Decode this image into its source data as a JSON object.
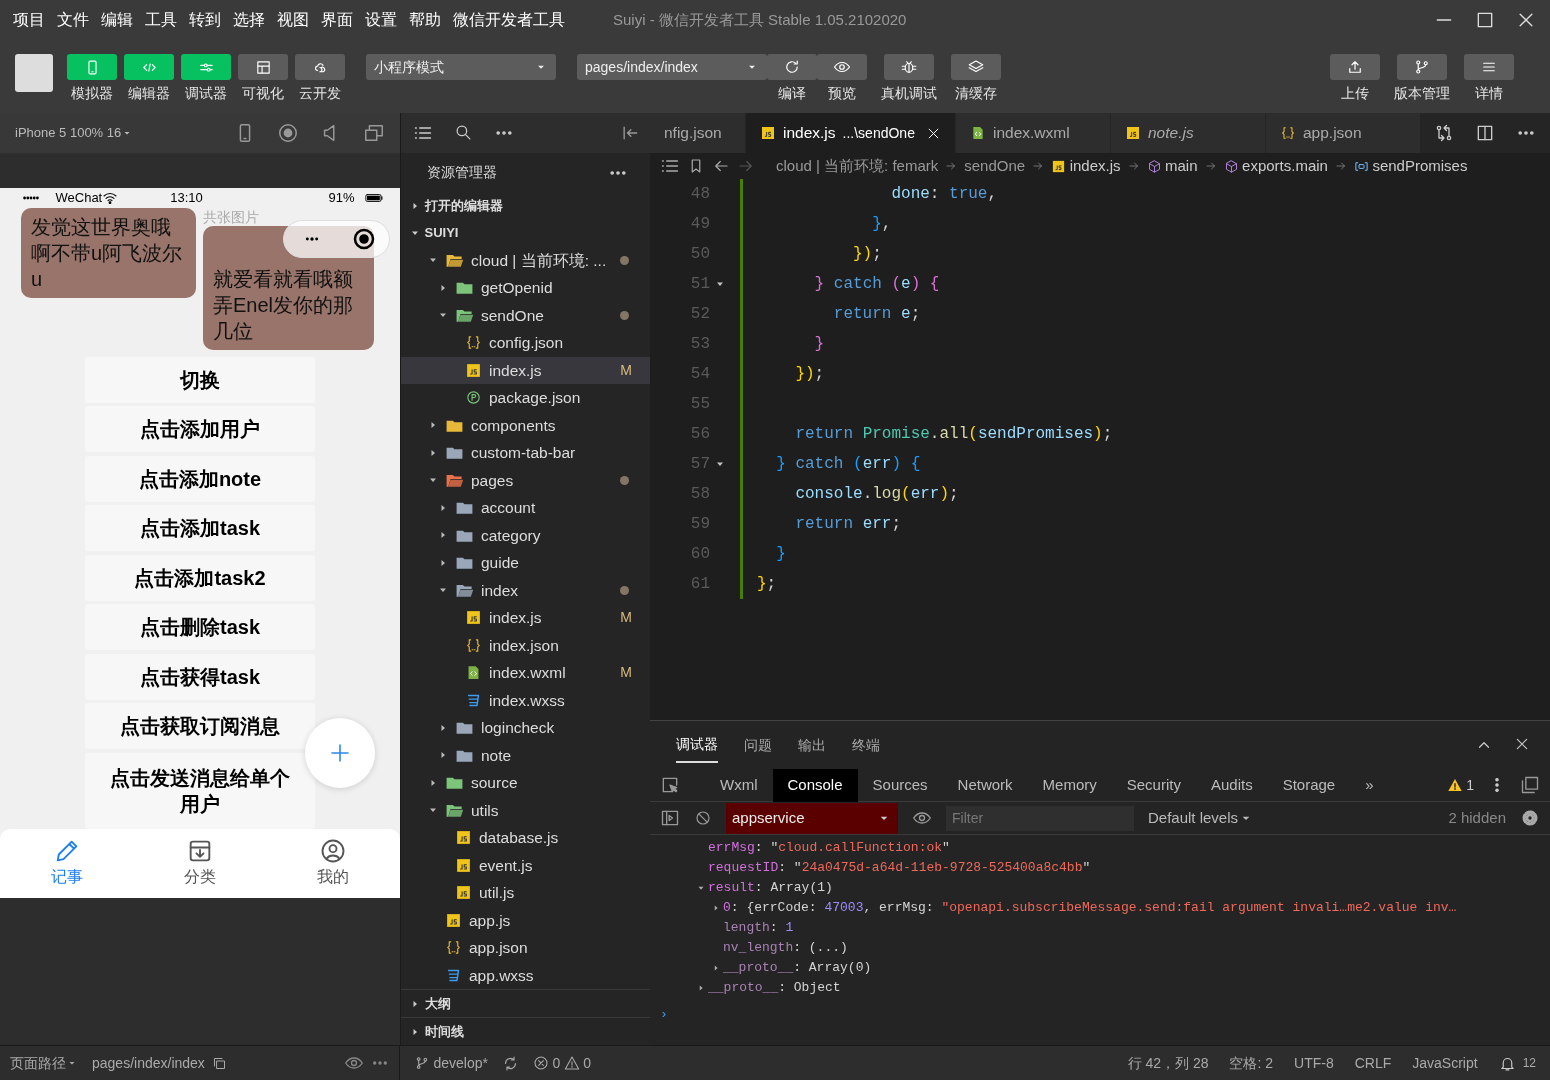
{
  "menu": [
    "项目",
    "文件",
    "编辑",
    "工具",
    "转到",
    "选择",
    "视图",
    "界面",
    "设置",
    "帮助",
    "微信开发者工具"
  ],
  "window": {
    "title": "Suiyi - 微信开发者工具 Stable 1.05.2102020"
  },
  "toolbar": {
    "toggles": [
      {
        "label": "模拟器",
        "kind": "phone",
        "on": true
      },
      {
        "label": "编辑器",
        "kind": "code",
        "on": true
      },
      {
        "label": "调试器",
        "kind": "sliders",
        "on": true
      },
      {
        "label": "可视化",
        "kind": "layout",
        "on": false
      },
      {
        "label": "云开发",
        "kind": "cloud",
        "on": false
      }
    ],
    "mode_select": "小程序模式",
    "page_select": "pages/index/index",
    "actions": [
      {
        "label": "编译",
        "kind": "refresh"
      },
      {
        "label": "预览",
        "kind": "eye"
      },
      {
        "label": "真机调试",
        "kind": "bug"
      },
      {
        "label": "清缓存",
        "kind": "layers"
      }
    ],
    "right_actions": [
      {
        "label": "上传",
        "kind": "upload"
      },
      {
        "label": "版本管理",
        "kind": "branch"
      },
      {
        "label": "详情",
        "kind": "menu"
      }
    ]
  },
  "simulator": {
    "device": "iPhone 5 100% 16",
    "status_bar": {
      "carrier": "WeChat",
      "time": "13:10",
      "battery": "91%"
    },
    "cards": [
      {
        "text": "发觉这世界奥哦啊不带u阿飞波尔u"
      },
      {
        "caption": "共张图片",
        "text": "就爱看就看哦额弄Enel发你的那几位"
      }
    ],
    "buttons": [
      "切换",
      "点击添加用户",
      "点击添加note",
      "点击添加task",
      "点击添加task2",
      "点击删除task",
      "点击获得task",
      "点击获取订阅消息",
      "点击发送消息给单个用户"
    ],
    "tab_bar": [
      {
        "label": "记事",
        "kind": "pencil",
        "selected": true
      },
      {
        "label": "分类",
        "kind": "inbox",
        "selected": false
      },
      {
        "label": "我的",
        "kind": "user",
        "selected": false
      }
    ]
  },
  "explorer": {
    "title": "资源管理器",
    "open_editors": {
      "label": "打开的编辑器",
      "expanded": false
    },
    "project": {
      "label": "SUIYI",
      "expanded": true,
      "tree": [
        {
          "name": "cloud | 当前环境: ...",
          "kind": "folder",
          "color": "#e8b83a",
          "expanded": true,
          "dirty": true,
          "selected": false,
          "children": [
            {
              "name": "getOpenid",
              "kind": "folder",
              "color": "#7cc47a",
              "expanded": false,
              "selected": false
            },
            {
              "name": "sendOne",
              "kind": "folder",
              "color": "#7cc47a",
              "expanded": true,
              "dirty": true,
              "selected": false,
              "children": [
                {
                  "name": "config.json",
                  "kind": "json",
                  "selected": false
                },
                {
                  "name": "index.js",
                  "kind": "js",
                  "status": "M",
                  "selected": true
                },
                {
                  "name": "package.json",
                  "kind": "package",
                  "selected": false
                }
              ]
            }
          ]
        },
        {
          "name": "components",
          "kind": "folder",
          "color": "#e8b83a",
          "expanded": false,
          "selected": false
        },
        {
          "name": "custom-tab-bar",
          "kind": "folder",
          "color": "#9aa7b8",
          "expanded": false,
          "selected": false
        },
        {
          "name": "pages",
          "kind": "folder",
          "color": "#e8704a",
          "expanded": true,
          "dirty": true,
          "selected": false,
          "children": [
            {
              "name": "account",
              "kind": "folder",
              "color": "#9aa7b8",
              "expanded": false,
              "selected": false
            },
            {
              "name": "category",
              "kind": "folder",
              "color": "#9aa7b8",
              "expanded": false,
              "selected": false
            },
            {
              "name": "guide",
              "kind": "folder",
              "color": "#9aa7b8",
              "expanded": false,
              "selected": false
            },
            {
              "name": "index",
              "kind": "folder",
              "color": "#9aa7b8",
              "expanded": true,
              "dirty": true,
              "selected": false,
              "children": [
                {
                  "name": "index.js",
                  "kind": "js",
                  "status": "M",
                  "selected": false
                },
                {
                  "name": "index.json",
                  "kind": "json",
                  "selected": false
                },
                {
                  "name": "index.wxml",
                  "kind": "wxml",
                  "status": "M",
                  "selected": false
                },
                {
                  "name": "index.wxss",
                  "kind": "wxss",
                  "selected": false
                }
              ]
            },
            {
              "name": "logincheck",
              "kind": "folder",
              "color": "#9aa7b8",
              "expanded": false,
              "selected": false
            },
            {
              "name": "note",
              "kind": "folder",
              "color": "#9aa7b8",
              "expanded": false,
              "selected": false
            }
          ]
        },
        {
          "name": "source",
          "kind": "folder",
          "color": "#7cc47a",
          "expanded": false,
          "selected": false
        },
        {
          "name": "utils",
          "kind": "folder",
          "color": "#7cc47a",
          "expanded": true,
          "selected": false,
          "children": [
            {
              "name": "database.js",
              "kind": "js",
              "selected": false
            },
            {
              "name": "event.js",
              "kind": "js",
              "selected": false
            },
            {
              "name": "util.js",
              "kind": "js",
              "selected": false
            }
          ]
        },
        {
          "name": "app.js",
          "kind": "js",
          "selected": false
        },
        {
          "name": "app.json",
          "kind": "json",
          "selected": false
        },
        {
          "name": "app.wxss",
          "kind": "wxss",
          "selected": false
        }
      ]
    },
    "outline": {
      "label": "大纲",
      "expanded": false
    },
    "timeline": {
      "label": "时间线",
      "expanded": false
    }
  },
  "editor": {
    "tabs": [
      {
        "label": "nfig.json",
        "selected": false,
        "preview": false
      },
      {
        "label": "index.js",
        "detail": "...\\sendOne",
        "kind": "js",
        "selected": true,
        "preview": false
      },
      {
        "label": "index.wxml",
        "kind": "wxml",
        "selected": false,
        "preview": false
      },
      {
        "label": "note.js",
        "kind": "js",
        "selected": false,
        "preview": true
      },
      {
        "label": "app.json",
        "kind": "json",
        "selected": false,
        "preview": false
      }
    ],
    "breadcrumb": [
      {
        "text": "cloud | 当前环境: femark"
      },
      {
        "text": "sendOne"
      },
      {
        "text": "index.js",
        "kind": "js"
      },
      {
        "text": "main",
        "kind": "module"
      },
      {
        "text": "exports.main",
        "kind": "module"
      },
      {
        "text": "sendPromises",
        "kind": "variable"
      }
    ],
    "lines": [
      {
        "number": "48",
        "tokens": [
          {
            "text": "              done",
            "kind": "var"
          },
          {
            "text": ": ",
            "kind": "punc"
          },
          {
            "text": "true",
            "kind": "kw"
          },
          {
            "text": ",",
            "kind": "punc"
          }
        ]
      },
      {
        "number": "49",
        "tokens": [
          {
            "text": "            }",
            "kind": "b3"
          },
          {
            "text": ",",
            "kind": "punc"
          }
        ]
      },
      {
        "number": "50",
        "tokens": [
          {
            "text": "          })",
            "kind": "b1"
          },
          {
            "text": ";",
            "kind": "punc"
          }
        ]
      },
      {
        "number": "51",
        "fold": true,
        "tokens": [
          {
            "text": "      }",
            "kind": "b2"
          },
          {
            "text": " catch ",
            "kind": "kw"
          },
          {
            "text": "(",
            "kind": "b2"
          },
          {
            "text": "e",
            "kind": "var"
          },
          {
            "text": ")",
            "kind": "b2"
          },
          {
            "text": " {",
            "kind": "b2"
          }
        ]
      },
      {
        "number": "52",
        "tokens": [
          {
            "text": "        return ",
            "kind": "kw"
          },
          {
            "text": "e",
            "kind": "var"
          },
          {
            "text": ";",
            "kind": "punc"
          }
        ]
      },
      {
        "number": "53",
        "tokens": [
          {
            "text": "      }",
            "kind": "b2"
          }
        ]
      },
      {
        "number": "54",
        "tokens": [
          {
            "text": "    })",
            "kind": "b1"
          },
          {
            "text": ";",
            "kind": "punc"
          }
        ]
      },
      {
        "number": "55"
      },
      {
        "number": "56",
        "tokens": [
          {
            "text": "    return ",
            "kind": "kw"
          },
          {
            "text": "Promise",
            "kind": "cls"
          },
          {
            "text": ".",
            "kind": "punc"
          },
          {
            "text": "all",
            "kind": "fn"
          },
          {
            "text": "(",
            "kind": "b1"
          },
          {
            "text": "sendPromises",
            "kind": "var"
          },
          {
            "text": ")",
            "kind": "b1"
          },
          {
            "text": ";",
            "kind": "punc"
          }
        ]
      },
      {
        "number": "57",
        "fold": true,
        "tokens": [
          {
            "text": "  }",
            "kind": "b3"
          },
          {
            "text": " catch ",
            "kind": "kw"
          },
          {
            "text": "(",
            "kind": "b3"
          },
          {
            "text": "err",
            "kind": "var"
          },
          {
            "text": ")",
            "kind": "b3"
          },
          {
            "text": " {",
            "kind": "b3"
          }
        ]
      },
      {
        "number": "58",
        "tokens": [
          {
            "text": "    console",
            "kind": "var"
          },
          {
            "text": ".",
            "kind": "punc"
          },
          {
            "text": "log",
            "kind": "fn"
          },
          {
            "text": "(",
            "kind": "b1"
          },
          {
            "text": "err",
            "kind": "var"
          },
          {
            "text": ")",
            "kind": "b1"
          },
          {
            "text": ";",
            "kind": "punc"
          }
        ]
      },
      {
        "number": "59",
        "tokens": [
          {
            "text": "    return ",
            "kind": "kw"
          },
          {
            "text": "err",
            "kind": "var"
          },
          {
            "text": ";",
            "kind": "punc"
          }
        ]
      },
      {
        "number": "60",
        "tokens": [
          {
            "text": "  }",
            "kind": "b3"
          }
        ]
      },
      {
        "number": "61",
        "tokens": [
          {
            "text": "}",
            "kind": "b1"
          },
          {
            "text": ";",
            "kind": "punc"
          }
        ]
      }
    ]
  },
  "debugger": {
    "panel_tabs": [
      {
        "label": "调试器",
        "selected": true
      },
      {
        "label": "问题",
        "selected": false
      },
      {
        "label": "输出",
        "selected": false
      },
      {
        "label": "终端",
        "selected": false
      }
    ],
    "devtools_tabs": [
      {
        "label": "Wxml",
        "selected": false
      },
      {
        "label": "Console",
        "selected": true
      },
      {
        "label": "Sources",
        "selected": false
      },
      {
        "label": "Network",
        "selected": false
      },
      {
        "label": "Memory",
        "selected": false
      },
      {
        "label": "Security",
        "selected": false
      },
      {
        "label": "Audits",
        "selected": false
      },
      {
        "label": "Storage",
        "selected": false
      }
    ],
    "more_tabs": "»",
    "warnings": "1",
    "context": "appservice",
    "filter": {
      "placeholder": "Filter"
    },
    "levels": "Default levels",
    "hidden": "2 hidden",
    "console": [
      {
        "parts": [
          {
            "text": "errMsg",
            "kind": "prop"
          },
          {
            "text": ": \"",
            "kind": "punc"
          },
          {
            "text": "cloud.callFunction:ok",
            "kind": "str"
          },
          {
            "text": "\"",
            "kind": "punc"
          }
        ]
      },
      {
        "parts": [
          {
            "text": "requestID",
            "kind": "prop"
          },
          {
            "text": ": \"",
            "kind": "punc"
          },
          {
            "text": "24a0475d-a64d-11eb-9728-525400a8c4bb",
            "kind": "str"
          },
          {
            "text": "\"",
            "kind": "punc"
          }
        ]
      },
      {
        "expanded": true,
        "parts": [
          {
            "text": "result",
            "kind": "prop"
          },
          {
            "text": ": Array(1)",
            "kind": "punc"
          }
        ],
        "children": [
          {
            "expanded": false,
            "parts": [
              {
                "text": "0",
                "kind": "prop"
              },
              {
                "text": ": {errCode: ",
                "kind": "punc"
              },
              {
                "text": "47003",
                "kind": "num"
              },
              {
                "text": ", errMsg: ",
                "kind": "punc"
              },
              {
                "text": "\"openapi.subscribeMessage.send:fail argument invali…me2.value inv…",
                "kind": "str"
              }
            ]
          },
          {
            "parts": [
              {
                "text": "length",
                "kind": "dim"
              },
              {
                "text": ": ",
                "kind": "punc"
              },
              {
                "text": "1",
                "kind": "num"
              }
            ]
          },
          {
            "parts": [
              {
                "text": "nv_length",
                "kind": "dim"
              },
              {
                "text": ": (...)",
                "kind": "punc"
              }
            ]
          },
          {
            "expanded": false,
            "parts": [
              {
                "text": "__proto__",
                "kind": "dim"
              },
              {
                "text": ": Array(0)",
                "kind": "punc"
              }
            ]
          }
        ]
      },
      {
        "expanded": false,
        "parts": [
          {
            "text": "__proto__",
            "kind": "dim"
          },
          {
            "text": ": Object",
            "kind": "punc"
          }
        ]
      }
    ],
    "prompt": "›"
  },
  "status_bar": {
    "page_path_label": "页面路径",
    "page_path": "pages/index/index",
    "branch": "develop*",
    "errors": "0",
    "warnings": "0",
    "items": [
      "行 42，列 28",
      "空格: 2",
      "UTF-8",
      "CRLF",
      "JavaScript"
    ],
    "notifications": "12"
  }
}
